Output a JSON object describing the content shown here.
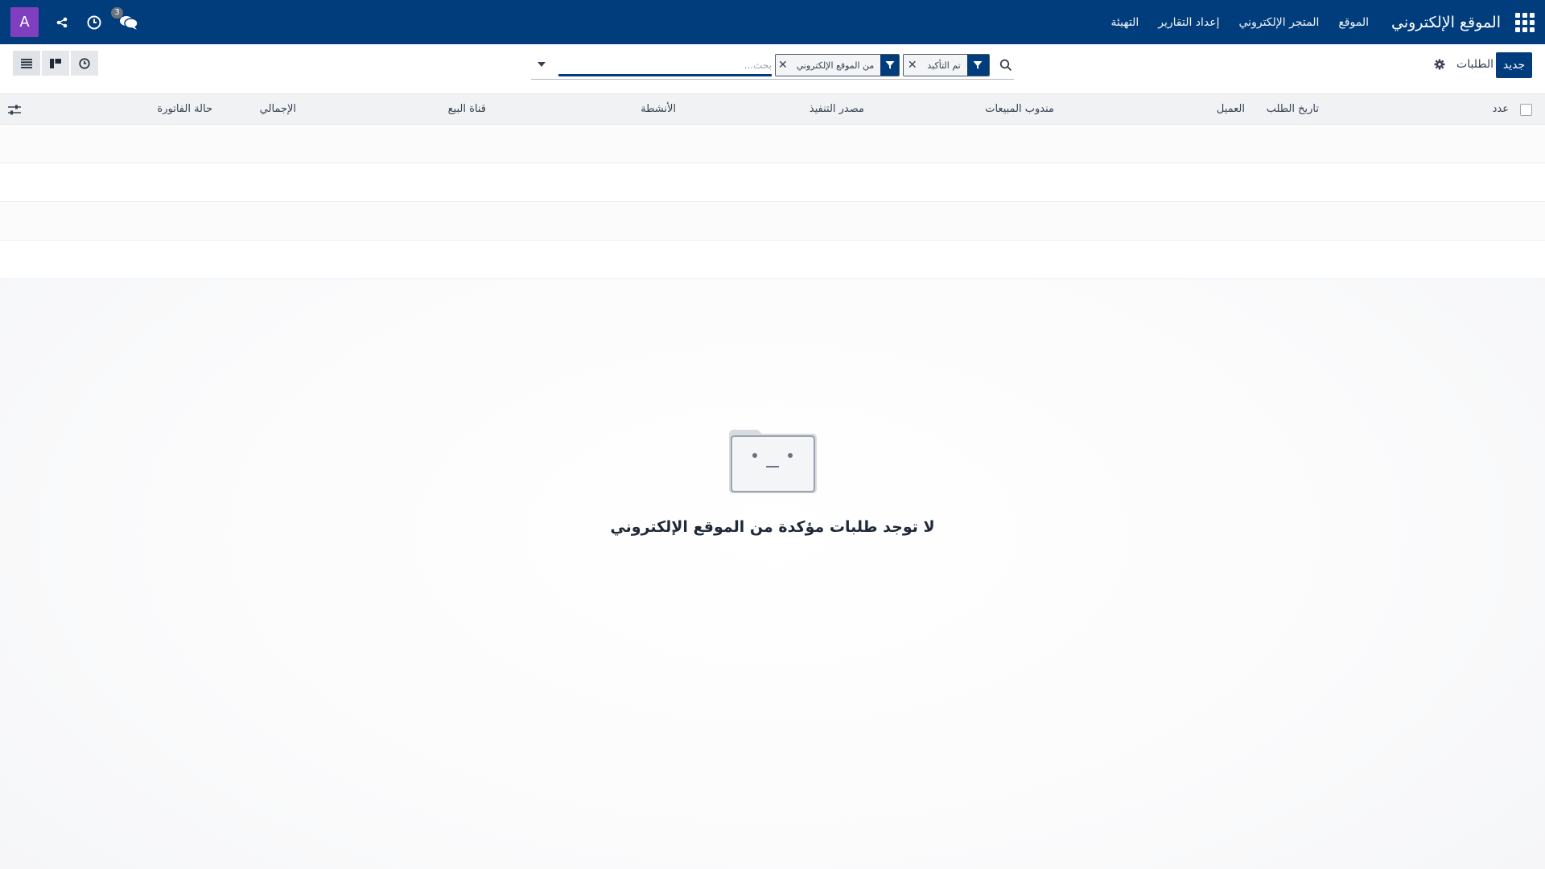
{
  "navbar": {
    "brand": "الموقع الإلكتروني",
    "menu": [
      "الموقع",
      "المتجر الإلكتروني",
      "إعداد التقارير",
      "التهيئة"
    ],
    "avatar_letter": "A",
    "messages_count": "3"
  },
  "control_panel": {
    "new_label": "جديد",
    "breadcrumb": "الطلبات",
    "search": {
      "facets": [
        "تم التأكيد",
        "من الموقع الإلكتروني"
      ],
      "placeholder": "بحث..."
    }
  },
  "list": {
    "columns": [
      "عدد",
      "تاريخ الطلب",
      "العميل",
      "مندوب المبيعات",
      "مصدر التنفيذ",
      "الأنشطة",
      "قناة البيع",
      "الإجمالي",
      "حالة الفاتورة"
    ]
  },
  "empty_state": {
    "title": "لا توجد طلبات مؤكدة من الموقع الإلكتروني"
  },
  "colors": {
    "brand": "#013d7c",
    "avatar": "#7f3fbf"
  }
}
